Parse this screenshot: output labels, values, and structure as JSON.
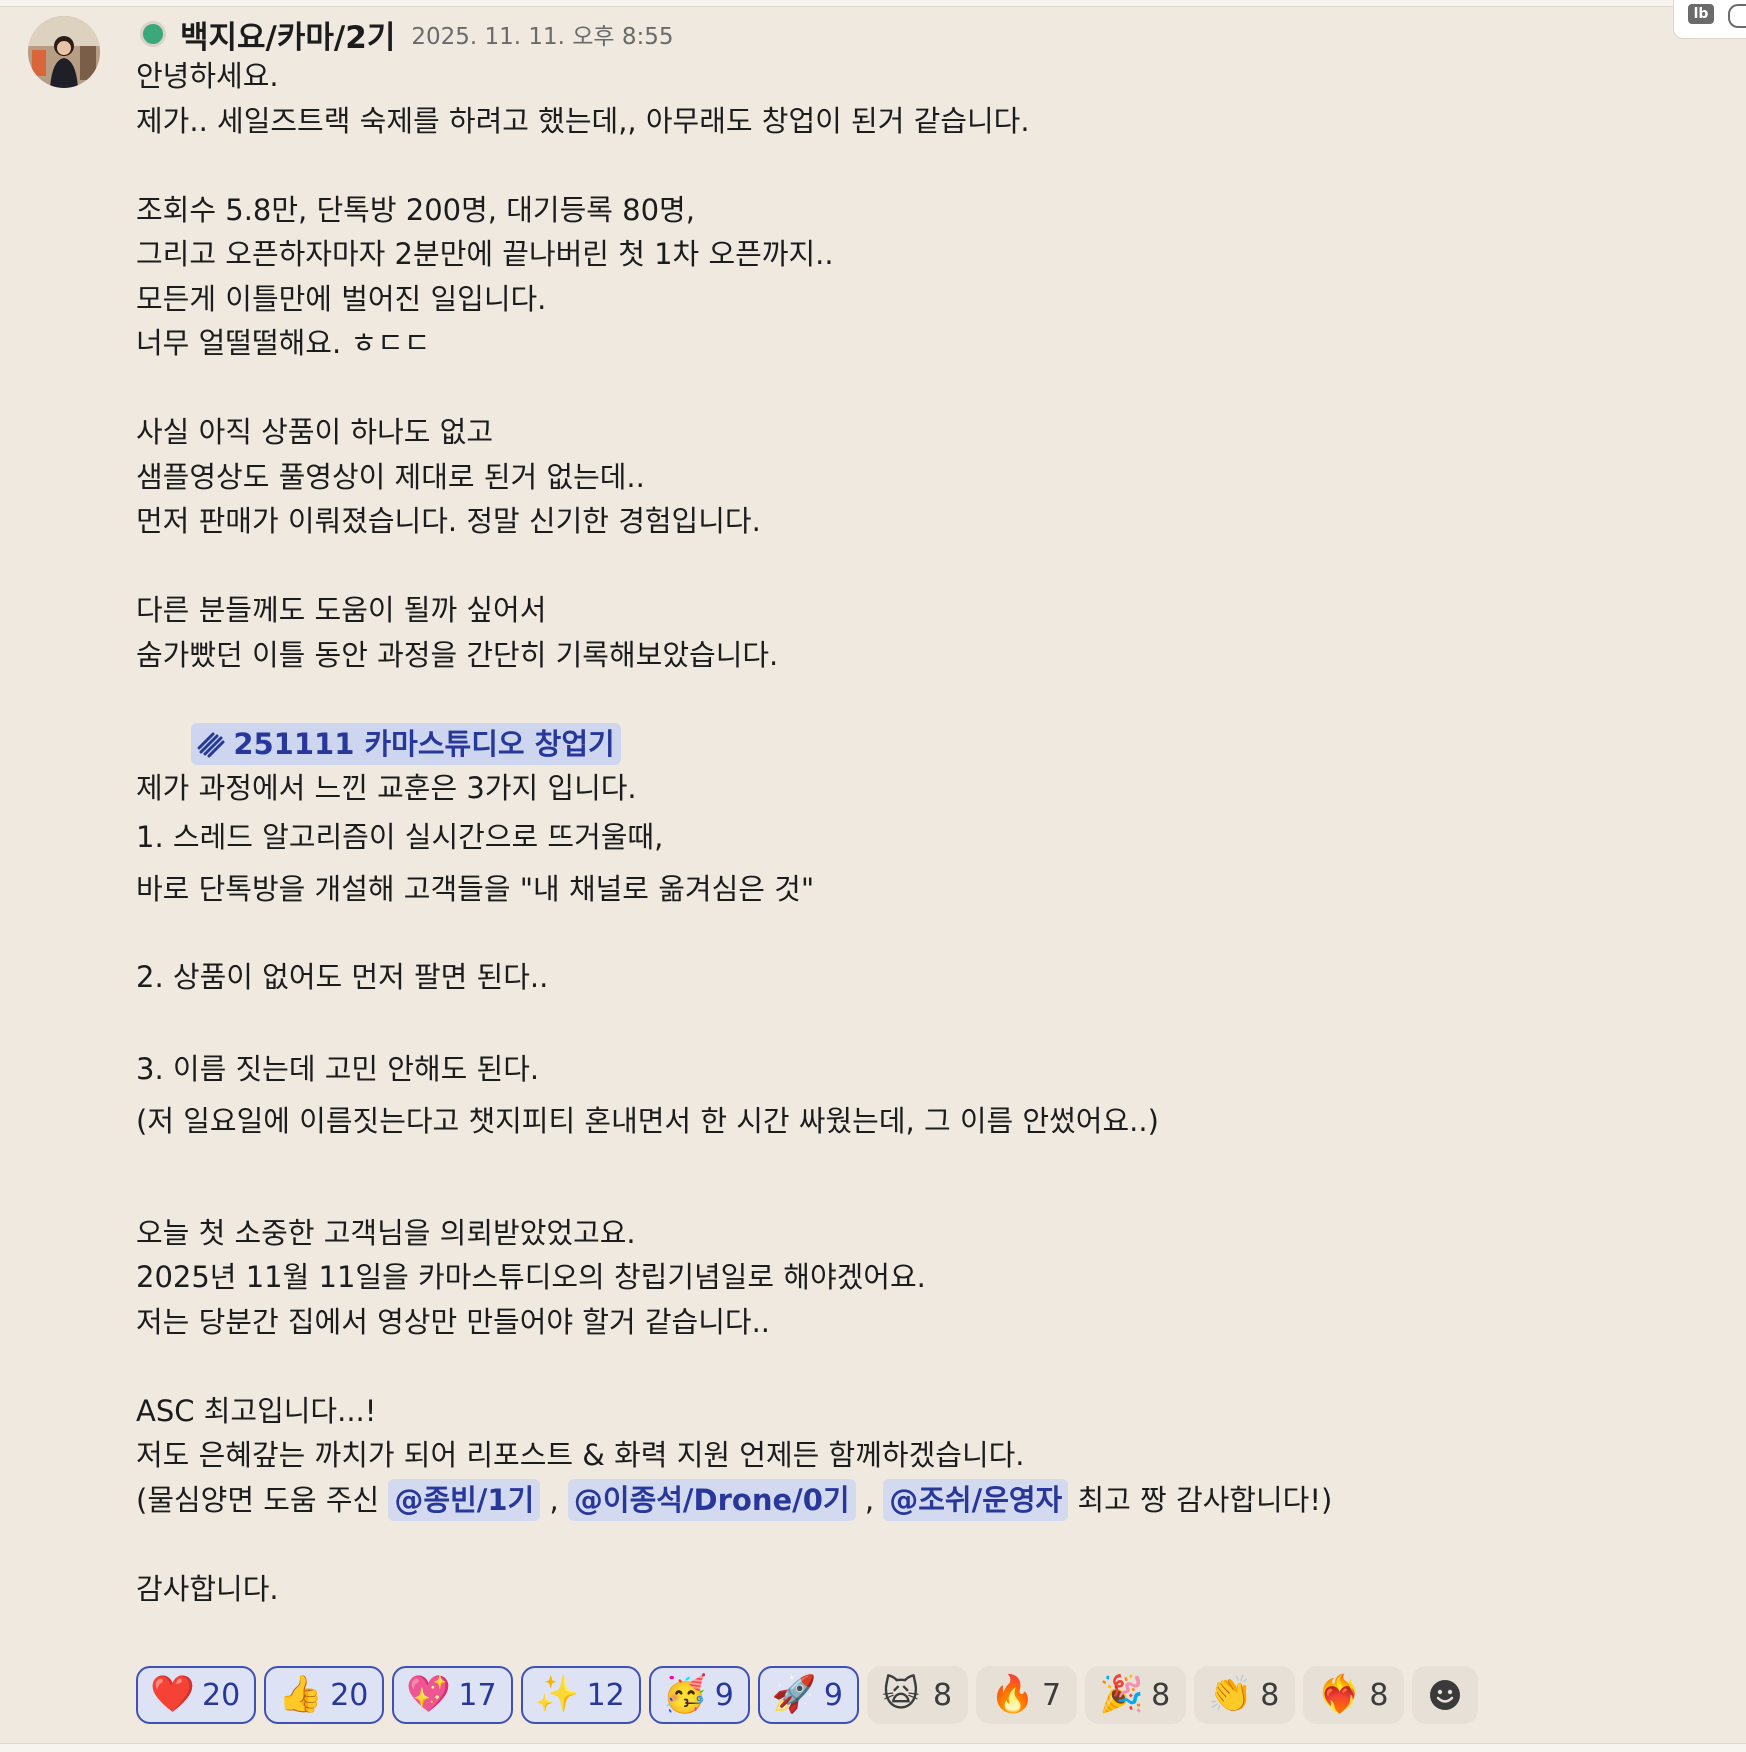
{
  "message": {
    "author": "백지요/카마/2기",
    "timestamp": "2025. 11. 11. 오후 8:55",
    "lines_a": [
      "안녕하세요.",
      "제가.. 세일즈트랙 숙제를 하려고 했는데,, 아무래도 창업이 된거 같습니다.",
      "",
      "조회수 5.8만, 단톡방 200명, 대기등록 80명,",
      "그리고 오픈하자마자 2분만에 끝나버린 첫 1차 오픈까지..",
      "모든게 이틀만에 벌어진 일입니다.",
      "너무 얼떨떨해요. ㅎㄷㄷ",
      "",
      "사실 아직 상품이 하나도 없고",
      "샘플영상도 풀영상이 제대로 된거 없는데..",
      "먼저 판매가 이뤄졌습니다. 정말 신기한 경험입니다.",
      "",
      "다른 분들께도 도움이 될까 싶어서",
      "숨가빴던 이틀 동안 과정을 간단히 기록해보았습니다."
    ],
    "canvas_link": "251111 카마스튜디오 창업기",
    "lessons_intro": "제가 과정에서 느낀 교훈은 3가지 입니다.",
    "lesson1_a": "1. 스레드 알고리즘이 실시간으로 뜨거울때,",
    "lesson1_b": "바로 단톡방을 개설해 고객들을 \"내 채널로 옮겨심은 것\"",
    "lesson2": "2. 상품이 없어도 먼저 팔면 된다..",
    "lesson3": "3. 이름 짓는데 고민 안해도 된다.",
    "lesson3_note": "(저 일요일에 이름짓는다고 챗지피티 혼내면서 한 시간 싸웠는데, 그 이름 안썼어요..)",
    "lines_b": [
      "오늘 첫 소중한 고객님을 의뢰받았었고요.",
      "2025년 11월 11일을 카마스튜디오의 창립기념일로 해야겠어요.",
      "저는 당분간 집에서 영상만 만들어야 할거 같습니다..",
      "",
      "ASC 최고입니다...!",
      "저도 은혜갚는 까치가 되어 리포스트 & 화력 지원 언제든 함께하겠습니다."
    ],
    "thanks_prefix": "(물심양면 도움 주신",
    "mentions": [
      "@종빈/1기",
      "@이종석/Drone/0기",
      "@조쉬/운영자"
    ],
    "thanks_suffix": "최고 짱 감사합니다!)",
    "separator": ",",
    "closing": "감사합니다."
  },
  "reactions": [
    {
      "emoji": "❤️",
      "icon": "heart-icon",
      "count": "20",
      "mine": true
    },
    {
      "emoji": "👍",
      "icon": "thumbs-up-icon",
      "count": "20",
      "mine": true
    },
    {
      "emoji": "💖",
      "icon": "sparkling-heart-icon",
      "count": "17",
      "mine": true
    },
    {
      "emoji": "✨",
      "icon": "sparkles-icon",
      "count": "12",
      "mine": true
    },
    {
      "emoji": "🥳",
      "icon": "party-face-icon",
      "count": "9",
      "mine": true
    },
    {
      "emoji": "🚀",
      "icon": "rocket-icon",
      "count": "9",
      "mine": true
    },
    {
      "emoji": "🙀",
      "icon": "shocked-cat-icon",
      "count": "8",
      "mine": false
    },
    {
      "emoji": "🔥",
      "icon": "fire-icon",
      "count": "7",
      "mine": false
    },
    {
      "emoji": "🎉",
      "icon": "party-popper-icon",
      "count": "8",
      "mine": false
    },
    {
      "emoji": "👏",
      "icon": "clapping-hands-icon",
      "count": "8",
      "mine": false
    },
    {
      "emoji": "❤️‍🔥",
      "icon": "heart-on-fire-icon",
      "count": "8",
      "mine": false
    }
  ],
  "colors": {
    "background": "#efe9e0",
    "mention_bg": "#d3d9ee",
    "mention_text": "#27389a",
    "reaction_border": "#3f51b5",
    "online": "#3aa87a"
  }
}
